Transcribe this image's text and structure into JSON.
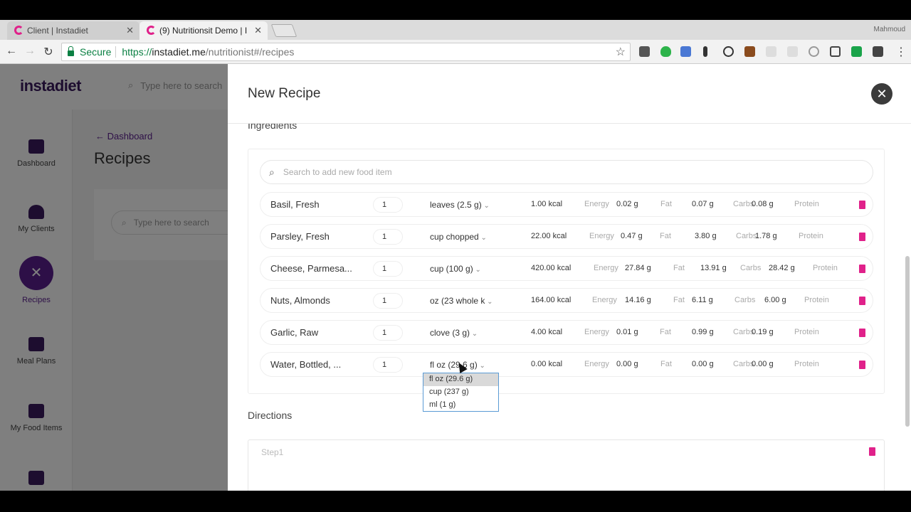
{
  "browser": {
    "tabs": [
      {
        "title": "Client | Instadiet"
      },
      {
        "title": "(9) Nutritionsit Demo | I"
      }
    ],
    "profile": "Mahmoud",
    "secure_label": "Secure",
    "url_scheme": "https://",
    "url_host": "instadiet.me",
    "url_path": "/nutritionist#/recipes"
  },
  "app": {
    "logo": "instadiet",
    "header_search_placeholder": "Type here to search",
    "nav": [
      {
        "label": "Dashboard"
      },
      {
        "label": "My Clients"
      },
      {
        "label": "Recipes"
      },
      {
        "label": "Meal Plans"
      },
      {
        "label": "My Food Items"
      }
    ],
    "breadcrumb": "Dashboard",
    "page_title": "Recipes",
    "list_search_placeholder": "Type here to search"
  },
  "panel": {
    "title": "New Recipe",
    "ingredients_label": "Ingredients",
    "food_search_placeholder": "Search to add new food item",
    "nutrient_labels": {
      "energy": "Energy",
      "fat": "Fat",
      "carbs": "Carbs",
      "protein": "Protein"
    },
    "ingredients": [
      {
        "name": "Basil, Fresh",
        "qty": "1",
        "unit": "leaves (2.5 g)",
        "kcal": "1.00 kcal",
        "fat": "0.02 g",
        "carbs": "0.07 g",
        "protein": "0.08 g"
      },
      {
        "name": "Parsley, Fresh",
        "qty": "1",
        "unit": "cup chopped",
        "kcal": "22.00 kcal",
        "fat": "0.47 g",
        "carbs": "3.80 g",
        "protein": "1.78 g"
      },
      {
        "name": "Cheese, Parmesa...",
        "qty": "1",
        "unit": "cup (100 g)",
        "kcal": "420.00 kcal",
        "fat": "27.84 g",
        "carbs": "13.91 g",
        "protein": "28.42 g"
      },
      {
        "name": "Nuts, Almonds",
        "qty": "1",
        "unit": "oz (23 whole k",
        "kcal": "164.00 kcal",
        "fat": "14.16 g",
        "carbs": "6.11 g",
        "protein": "6.00 g"
      },
      {
        "name": "Garlic, Raw",
        "qty": "1",
        "unit": "clove (3 g)",
        "kcal": "4.00 kcal",
        "fat": "0.01 g",
        "carbs": "0.99 g",
        "protein": "0.19 g"
      },
      {
        "name": "Water, Bottled, ...",
        "qty": "1",
        "unit": "fl oz (29.6 g)",
        "kcal": "0.00 kcal",
        "fat": "0.00 g",
        "carbs": "0.00 g",
        "protein": "0.00 g"
      }
    ],
    "unit_dropdown": {
      "options": [
        "fl oz (29.6 g)",
        "cup (237 g)",
        "ml (1 g)"
      ],
      "selected": "fl oz (29.6 g)"
    },
    "directions_label": "Directions",
    "step_placeholder": "Step1"
  },
  "colors": {
    "brand": "#5b1f8e",
    "danger": "#e0218a",
    "secure": "#0b8043"
  }
}
